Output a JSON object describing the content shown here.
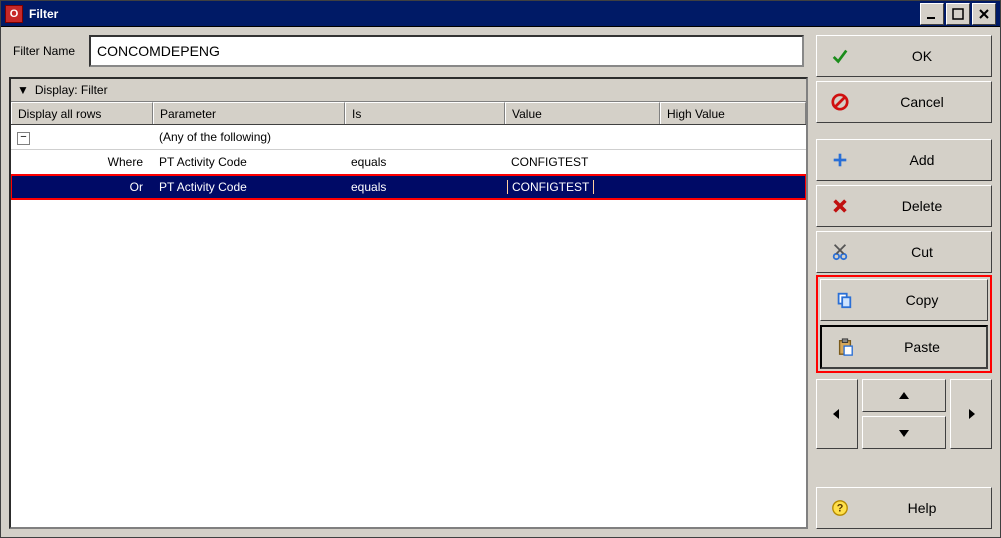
{
  "window": {
    "title": "Filter",
    "app_letter": "O"
  },
  "filter_name": {
    "label": "Filter Name",
    "value": "CONCOMDEPENG"
  },
  "section_label": "Display: Filter",
  "columns": {
    "c0": "Display all rows",
    "c1": "Parameter",
    "c2": "Is",
    "c3": "Value",
    "c4": "High Value"
  },
  "group_label": "(Any of the following)",
  "rows": [
    {
      "op": "Where",
      "param": "PT Activity Code",
      "is": "equals",
      "value": "CONFIGTEST",
      "high": "",
      "selected": false
    },
    {
      "op": "Or",
      "param": "PT Activity Code",
      "is": "equals",
      "value": "CONFIGTEST",
      "high": "",
      "selected": true
    }
  ],
  "buttons": {
    "ok": "OK",
    "cancel": "Cancel",
    "add": "Add",
    "delete": "Delete",
    "cut": "Cut",
    "copy": "Copy",
    "paste": "Paste",
    "help": "Help"
  }
}
